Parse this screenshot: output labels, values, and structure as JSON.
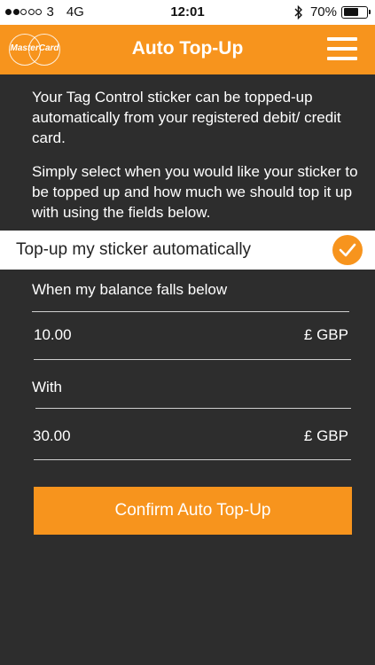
{
  "status_bar": {
    "carrier": "3",
    "network": "4G",
    "time": "12:01",
    "battery_text": "70%",
    "battery_level": 0.7,
    "signal_bars_filled": 2,
    "signal_bars_total": 5
  },
  "header": {
    "logo_text": "MasterCard",
    "title": "Auto Top-Up",
    "menu_icon": "hamburger-menu-icon",
    "background_color": "#f7941d"
  },
  "intro": {
    "paragraph_1": "Your Tag Control sticker can be topped-up automatically from your registered debit/ credit card.",
    "paragraph_2": "Simply select when you would like your sticker to be topped up and how much we should top it up with using the fields below."
  },
  "auto_toggle": {
    "label": "Top-up my sticker automatically",
    "checked": true,
    "icon": "checkmark-icon"
  },
  "form": {
    "threshold_label": "When my balance falls below",
    "threshold_value": "10.00",
    "threshold_unit": "£ GBP",
    "amount_label": "With",
    "amount_value": "30.00",
    "amount_unit": "£ GBP"
  },
  "confirm_button": {
    "label": "Confirm Auto Top-Up"
  },
  "colors": {
    "accent": "#f7941d",
    "background": "#2d2d2d"
  }
}
